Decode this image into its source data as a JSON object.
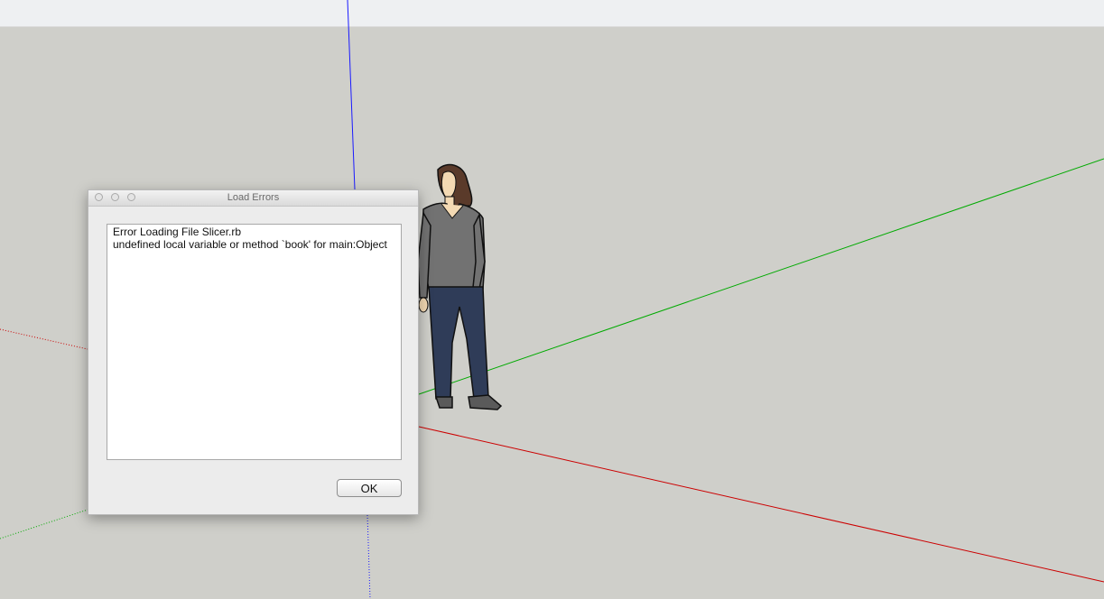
{
  "dialog": {
    "title": "Load Errors",
    "lines": [
      "Error Loading File Slicer.rb",
      "undefined local variable or method `book' for main:Object"
    ],
    "ok_label": "OK"
  },
  "colors": {
    "background": "#cfcfca",
    "red_axis": "#cc0000",
    "green_axis": "#00aa00",
    "blue_axis": "#1a1aff"
  }
}
